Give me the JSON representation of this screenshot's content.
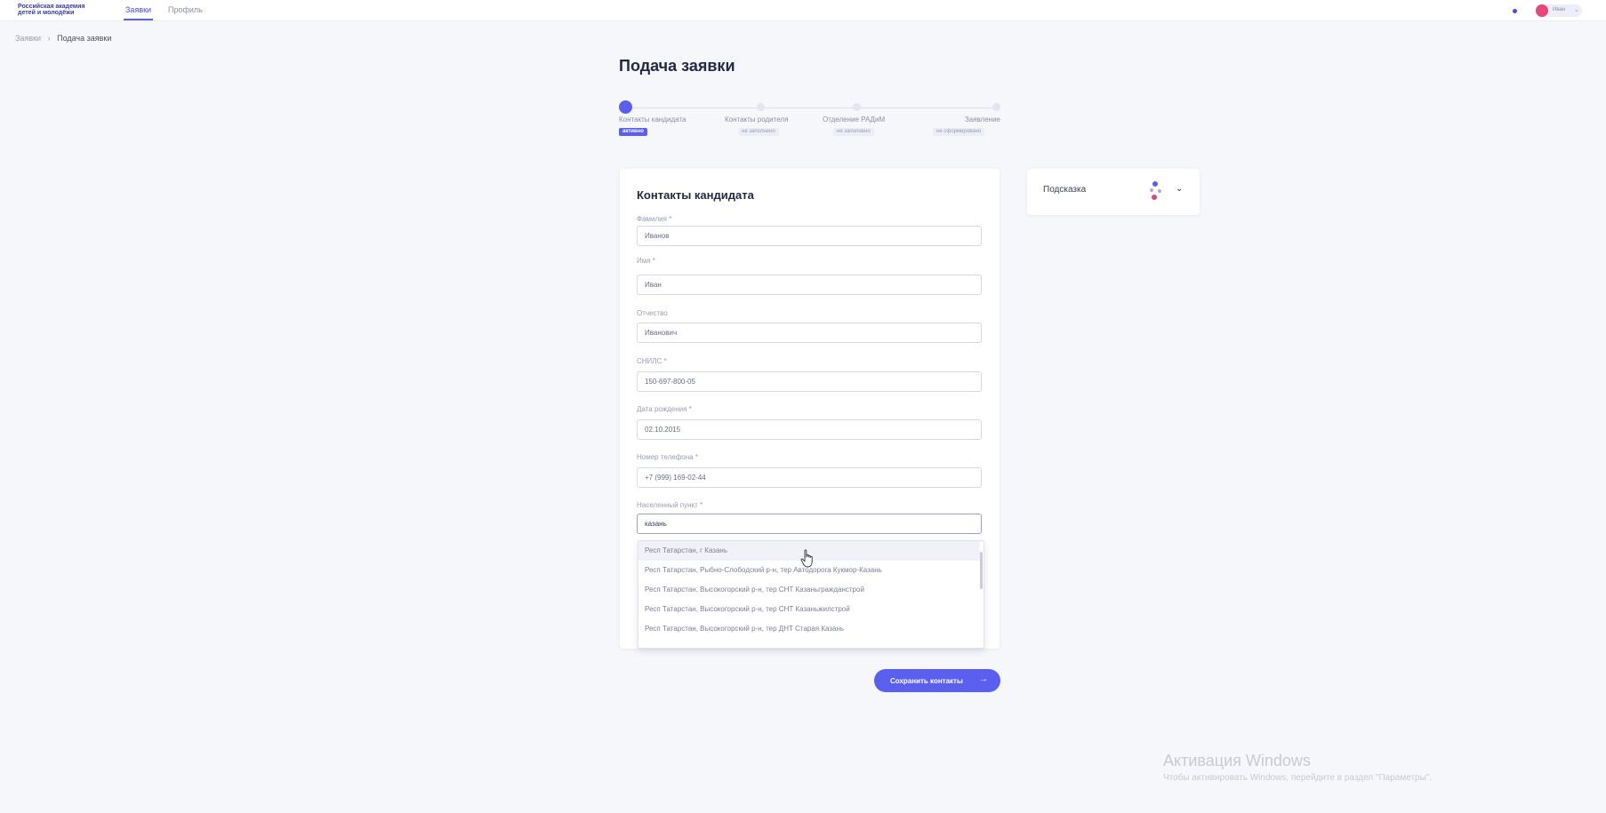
{
  "header": {
    "logo_line1": "Российская академия",
    "logo_line2": "детей и молодёжи",
    "tabs": [
      {
        "label": "Заявки",
        "active": true
      },
      {
        "label": "Профиль",
        "active": false
      }
    ],
    "user_name": "Иван",
    "user_caret": "⌄",
    "accent": "#5b5ff0",
    "avatar_color": "#e8457b"
  },
  "breadcrumb": {
    "items": [
      "Заявки",
      "Подача заявки"
    ],
    "separator": "›"
  },
  "page": {
    "title": "Подача заявки"
  },
  "stepper": {
    "steps": [
      {
        "label": "Контакты кандидата",
        "badge": "активно",
        "active": true
      },
      {
        "label": "Контакты родителя",
        "badge": "не заполнено",
        "active": false
      },
      {
        "label": "Отделение РАДиМ",
        "badge": "не заполнено",
        "active": false
      },
      {
        "label": "Заявление",
        "badge": "не сформировано",
        "active": false
      }
    ]
  },
  "form": {
    "title": "Контакты кандидата",
    "fields": [
      {
        "label": "Фамилия *",
        "value": "Иванов"
      },
      {
        "label": "Имя *",
        "value": "Иван"
      },
      {
        "label": "Отчество",
        "value": "Иванович"
      },
      {
        "label": "СНИЛС *",
        "value": "150-697-800-05"
      },
      {
        "label": "Дата рождения *",
        "value": "02.10.2015"
      },
      {
        "label": "Номер телефона *",
        "value": "+7 (999) 169-02-44"
      },
      {
        "label": "Населенный пункт *",
        "value": "казань"
      }
    ],
    "suggestions": [
      "Респ Татарстан, г Казань",
      "Респ Татарстан, Рыбно-Слободский р-н, тер Автодорога Кукмор-Казань",
      "Респ Татарстан, Высокогорский р-н, тер СНТ Казаньгражданстрой",
      "Респ Татарстан, Высокогорский р-н, тер СНТ Казаньжилстрой",
      "Респ Татарстан, Высокогорский р-н, тер ДНТ Старая Казань"
    ],
    "save_label": "Сохранить контакты",
    "save_arrow": "→"
  },
  "hint": {
    "title": "Подсказка",
    "chevron": "⌄",
    "colors": [
      "#5b5ff0",
      "#e8457b",
      "#aab0cc"
    ]
  },
  "watermark": {
    "title": "Активация Windows",
    "subtitle": "Чтобы активировать Windows, перейдите в раздел \"Параметры\"."
  }
}
